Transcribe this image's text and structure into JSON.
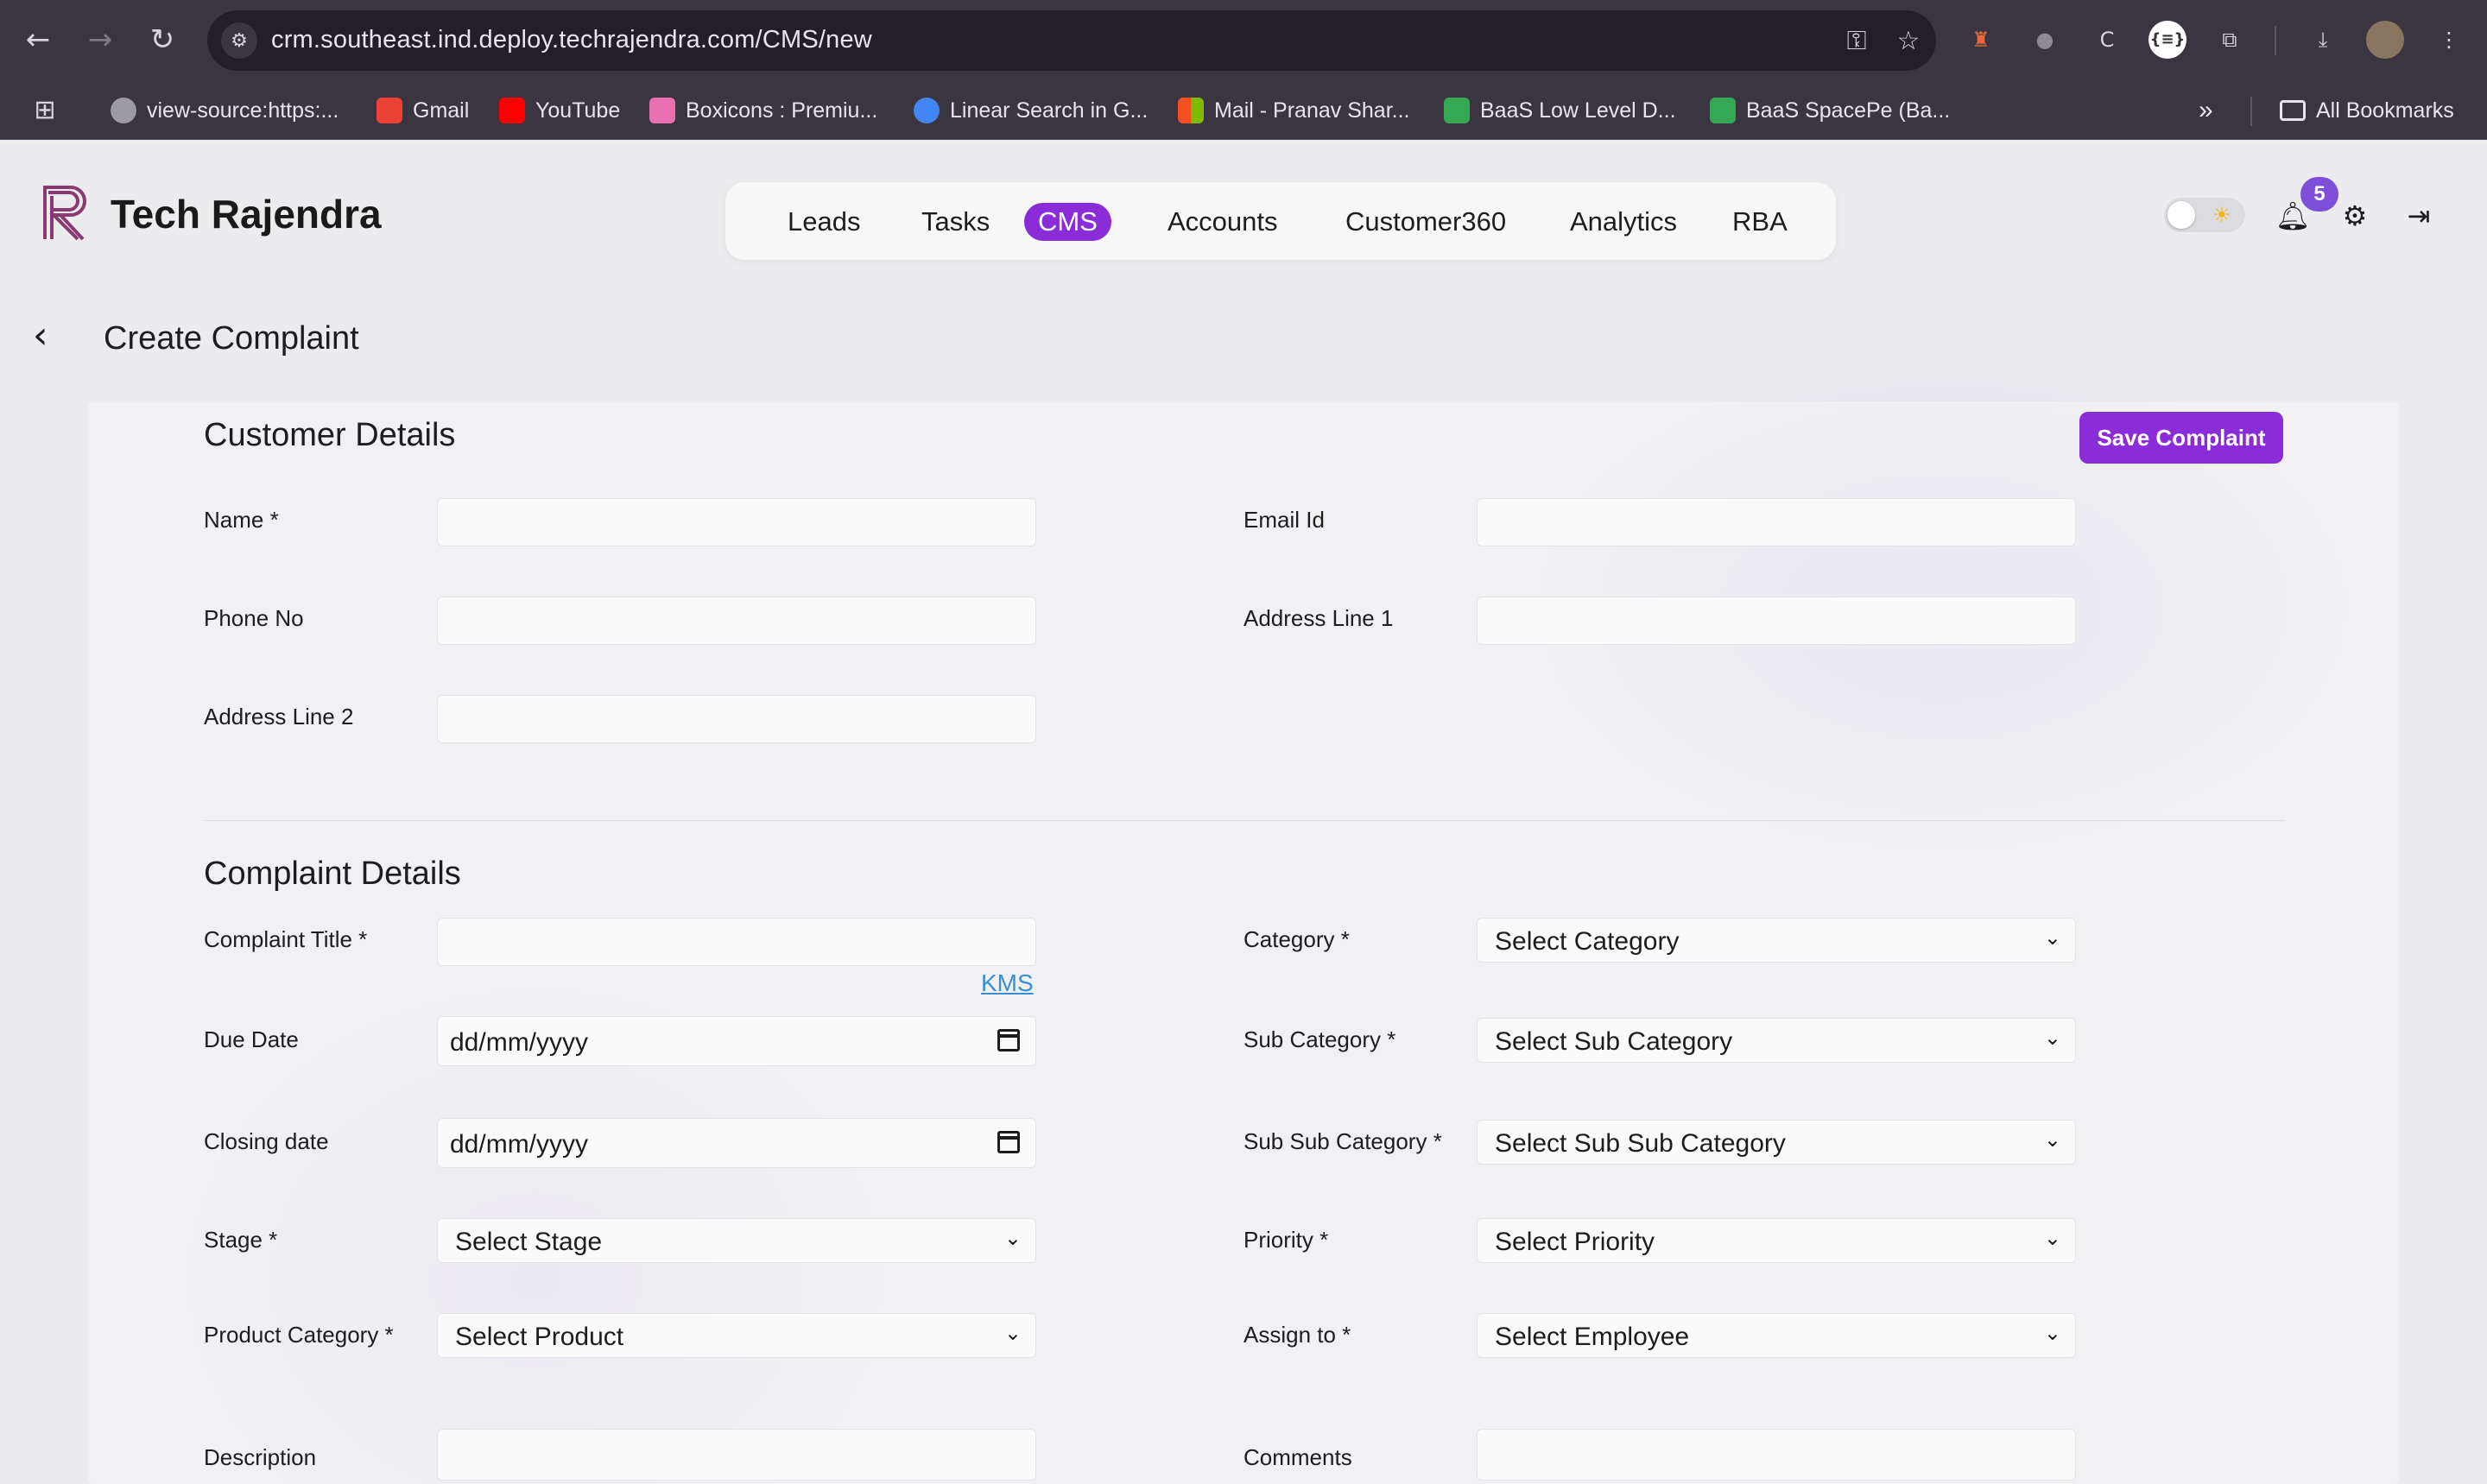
{
  "browser": {
    "url": "crm.southeast.ind.deploy.techrajendra.com/CMS/new",
    "bookmarks": [
      {
        "label": "view-source:https:...",
        "color": "#9a9aa0"
      },
      {
        "label": "Gmail",
        "color": "#ea4335"
      },
      {
        "label": "YouTube",
        "color": "#ff0000"
      },
      {
        "label": "Boxicons : Premiu...",
        "color": "#e86fb0"
      },
      {
        "label": "Linear Search in G...",
        "color": "#4285f4"
      },
      {
        "label": "Mail - Pranav Shar...",
        "color": "#f25022"
      },
      {
        "label": "BaaS Low Level D...",
        "color": "#34a853"
      },
      {
        "label": "BaaS SpacePe (Ba...",
        "color": "#34a853"
      }
    ],
    "overflow_label": "»",
    "all_bookmarks": "All Bookmarks",
    "extensions_badge": "{≡}"
  },
  "app": {
    "brand": "Tech Rajendra",
    "nav": [
      "Leads",
      "Tasks",
      "CMS",
      "Accounts",
      "Customer360",
      "Analytics",
      "RBA"
    ],
    "active_nav": "CMS",
    "notifications_count": "5",
    "accent": "#8b2cd9"
  },
  "page": {
    "back_glyph": "‹",
    "title": "Create Complaint",
    "save_button": "Save Complaint"
  },
  "customer": {
    "title": "Customer Details",
    "name_label": "Name *",
    "email_label": "Email Id",
    "phone_label": "Phone No",
    "address1_label": "Address Line 1",
    "address2_label": "Address Line 2"
  },
  "complaint": {
    "title": "Complaint Details",
    "complaint_title_label": "Complaint Title *",
    "kms_link": "KMS",
    "due_date_label": "Due Date",
    "due_date_placeholder": "dd/mm/yyyy",
    "closing_date_label": "Closing date",
    "closing_date_placeholder": "dd/mm/yyyy",
    "stage_label": "Stage *",
    "stage_value": "Select Stage",
    "product_label": "Product Category *",
    "product_value": "Select Product",
    "description_label": "Description",
    "category_label": "Category *",
    "category_value": "Select Category",
    "subcategory_label": "Sub Category *",
    "subcategory_value": "Select Sub Category",
    "subsubcategory_label": "Sub Sub Category *",
    "subsubcategory_value": "Select Sub Sub Category",
    "priority_label": "Priority *",
    "priority_value": "Select Priority",
    "assign_label": "Assign to *",
    "assign_value": "Select Employee",
    "comments_label": "Comments"
  }
}
